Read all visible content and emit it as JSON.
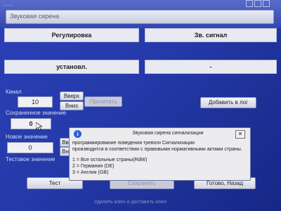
{
  "window": {
    "title": "Звуковая сирена"
  },
  "table": {
    "headers": [
      "Регулировка",
      "Зв. сигнал"
    ],
    "values": [
      "установл.",
      "-"
    ]
  },
  "form": {
    "channel_label": "Канал",
    "channel_value": "10",
    "up_button": "Вверх",
    "down_button": "Вниз",
    "read_button": "Прочитать",
    "add_log_button": "Добавить в лог",
    "saved_label": "Сохраненное значение",
    "saved_value": "0",
    "new_label": "Новое значение",
    "new_value": "0",
    "test_label": "Тестовое значение"
  },
  "dialog": {
    "title": "Звуковая сирена сигнализации",
    "line1": "программирование поведения тревоги Сигнализации",
    "line2": "производится в соответствии с правовыми нормативными актами страны.",
    "option1": "1 = Все остальные страны(RdW)",
    "option2": "2 = Германия (DE)",
    "option3": "3 = Англия (GB)"
  },
  "buttons": {
    "test": "Тест",
    "save": "Сохранить",
    "done": "Готово, Назад"
  },
  "footer": {
    "line2": "Удалить ключ и доставить ключ"
  }
}
